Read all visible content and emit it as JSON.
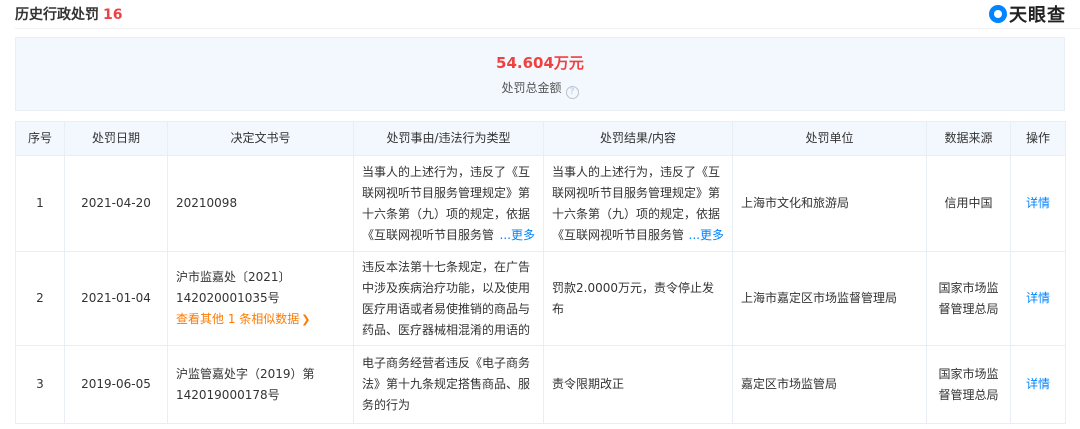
{
  "header": {
    "title": "历史行政处罚",
    "count": "16",
    "brand": "天眼查"
  },
  "summary": {
    "amount": "54.604万元",
    "label": "处罚总金额",
    "help": "?"
  },
  "columns": [
    "序号",
    "处罚日期",
    "决定文书号",
    "处罚事由/违法行为类型",
    "处罚结果/内容",
    "处罚单位",
    "数据来源",
    "操作"
  ],
  "rows": [
    {
      "index": "1",
      "date": "2021-04-20",
      "doc_no": "20210098",
      "reason": "当事人的上述行为，违反了《互联网视听节目服务管理规定》第十六条第（九）项的规定，依据《互联网视听节目服务管",
      "reason_more": "...更多",
      "result": "当事人的上述行为，违反了《互联网视听节目服务管理规定》第十六条第（九）项的规定，依据《互联网视听节目服务管",
      "result_more": "...更多",
      "unit": "上海市文化和旅游局",
      "source": "信用中国",
      "action": "详情"
    },
    {
      "index": "2",
      "date": "2021-01-04",
      "doc_no": "沪市监嘉处〔2021〕142020001035号",
      "similar": "查看其他 1 条相似数据",
      "reason": "违反本法第十七条规定，在广告中涉及疾病治疗功能，以及使用医疗用语或者易使推销的商品与药品、医疗器械相混淆的用语的",
      "result": "罚款2.0000万元，责令停止发布",
      "unit": "上海市嘉定区市场监督管理局",
      "source": "国家市场监督管理总局",
      "action": "详情"
    },
    {
      "index": "3",
      "date": "2019-06-05",
      "doc_no": "沪监管嘉处字（2019）第142019000178号",
      "reason": "电子商务经营者违反《电子商务法》第十九条规定搭售商品、服务的行为",
      "result": "责令限期改正",
      "unit": "嘉定区市场监管局",
      "source": "国家市场监督管理总局",
      "action": "详情"
    }
  ],
  "colors": {
    "accent": "#0084ff",
    "amount": "#f04141",
    "similar": "#ff7a00",
    "header_bg": "#f3f8fe"
  }
}
